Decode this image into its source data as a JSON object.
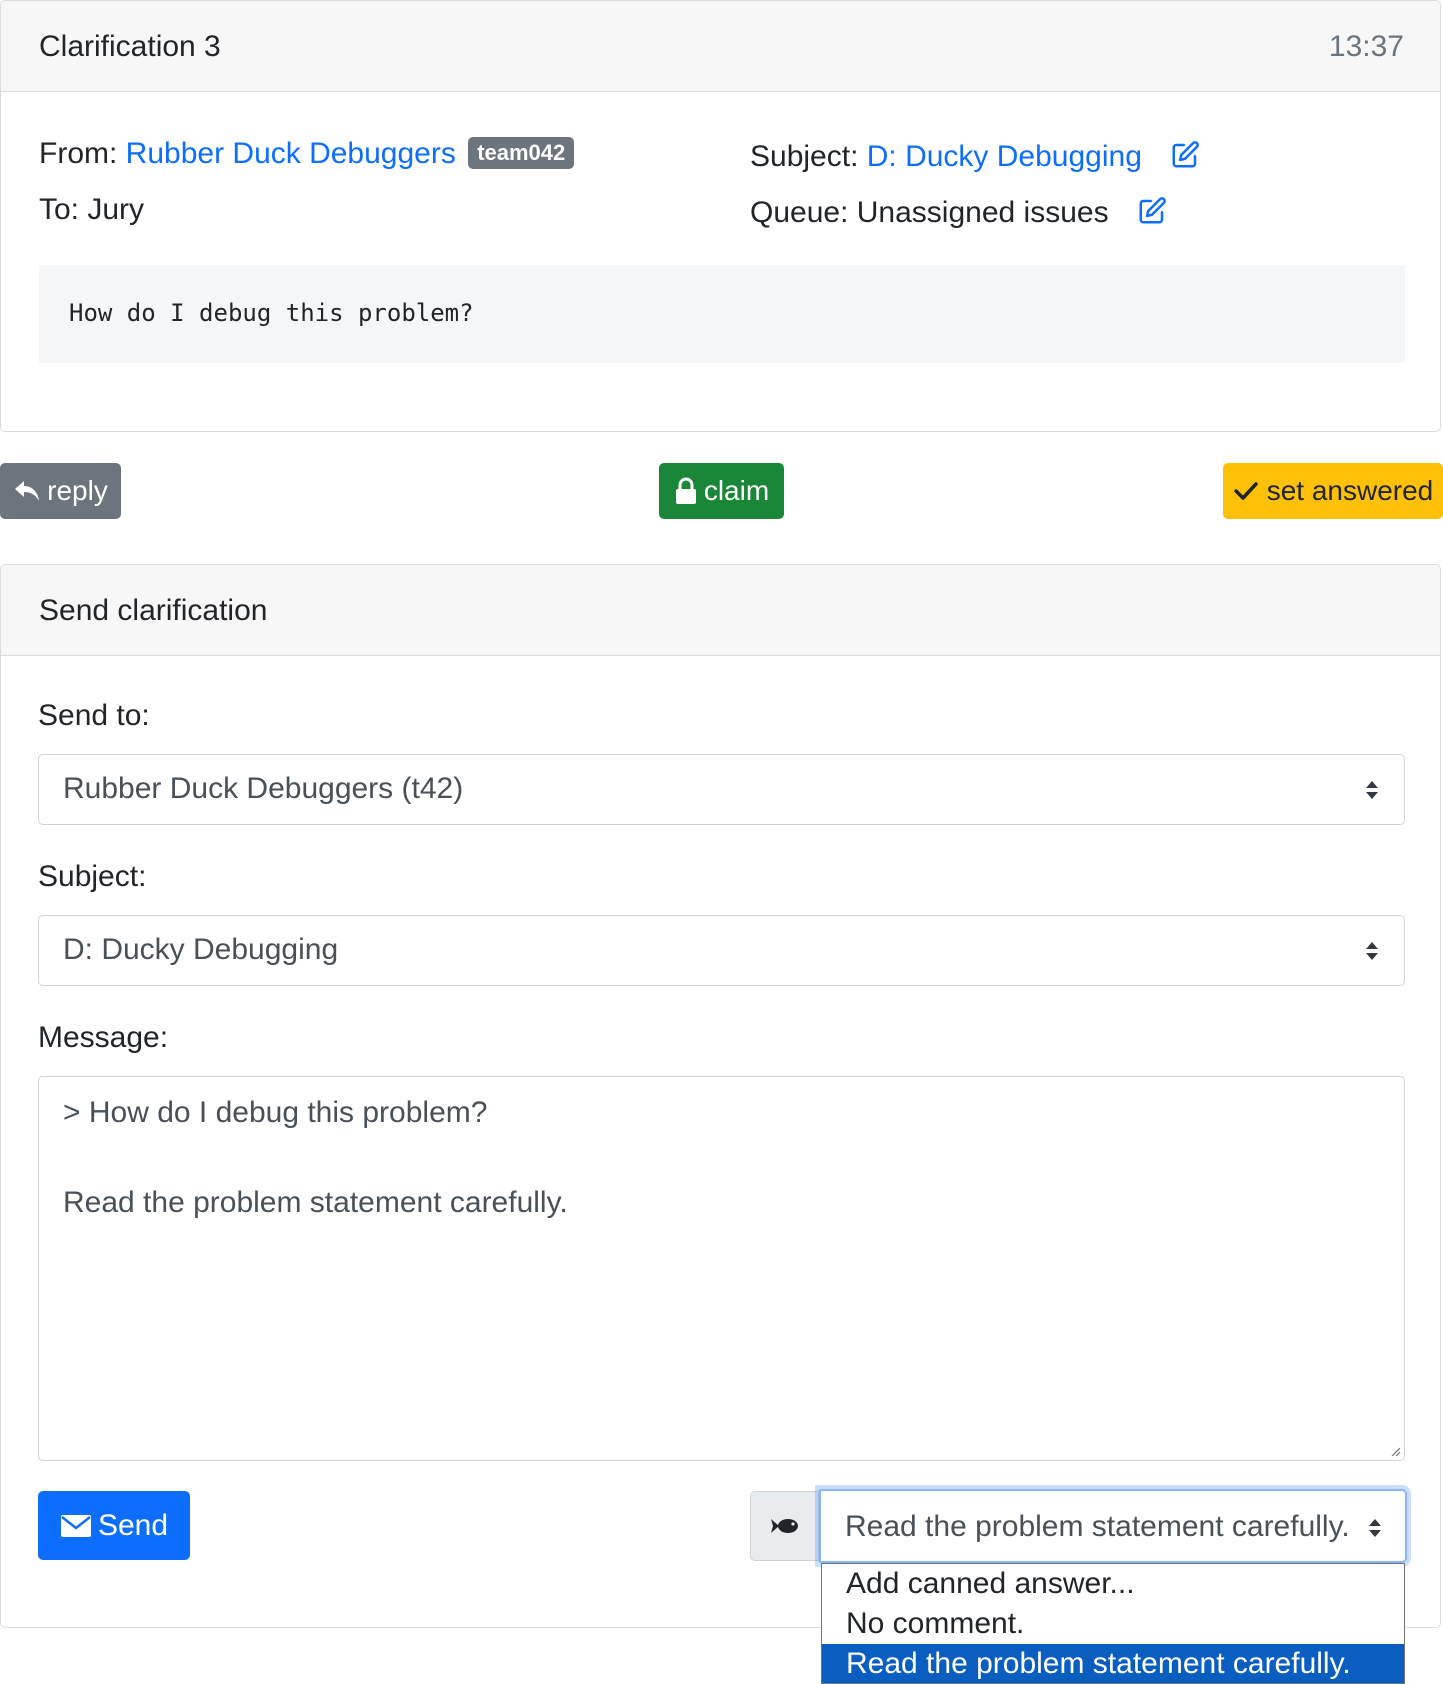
{
  "clarification": {
    "title": "Clarification 3",
    "time": "13:37",
    "from_label": "From:",
    "from_team": "Rubber Duck Debuggers",
    "team_badge": "team042",
    "to_label": "To:",
    "to_value": "Jury",
    "subject_label": "Subject:",
    "subject_value": "D: Ducky Debugging",
    "queue_label": "Queue:",
    "queue_value": "Unassigned issues",
    "body": "How do I debug this problem?"
  },
  "actions": {
    "reply_label": "reply",
    "claim_label": "claim",
    "set_answered_label": "set answered"
  },
  "send_form": {
    "title": "Send clarification",
    "send_to_label": "Send to:",
    "send_to_value": "Rubber Duck Debuggers (t42)",
    "subject_label": "Subject:",
    "subject_value": "D: Ducky Debugging",
    "message_label": "Message:",
    "message_lines": [
      "> How do I debug this problem?",
      "Read the problem statement carefully."
    ],
    "send_button_label": "Send",
    "canned_selected": "Read the problem statement carefully.",
    "canned_options": [
      "Add canned answer...",
      "No comment.",
      "Read the problem statement carefully."
    ]
  },
  "colors": {
    "link": "#0d6efd",
    "reply_button": "#6c757d",
    "claim_button": "#198737",
    "answered_button": "#ffc107",
    "send_button": "#0d6efd",
    "dropdown_selected": "#0a5ec0"
  },
  "icons": {
    "reply": "reply-arrow-icon",
    "claim": "lock-icon",
    "answered": "check-icon",
    "edit": "edit-icon",
    "send": "envelope-icon",
    "canned": "fish-icon",
    "select": "sort-arrows-icon"
  }
}
